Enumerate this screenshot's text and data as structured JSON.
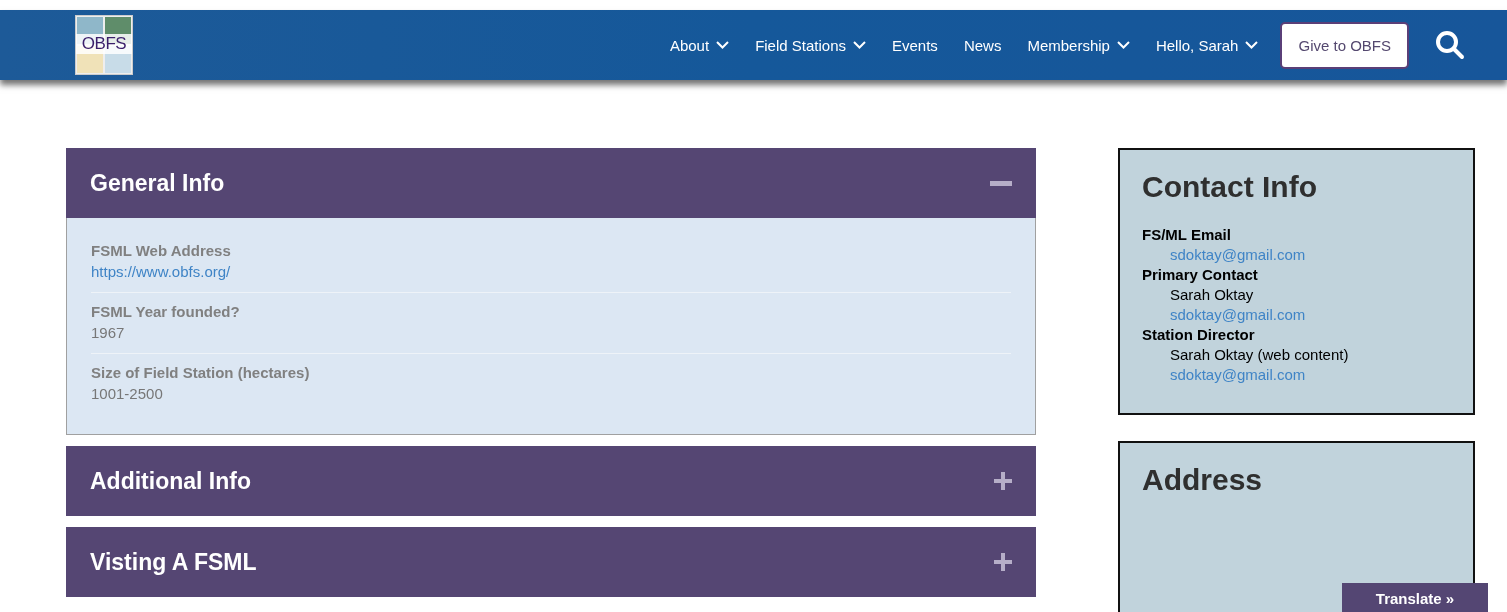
{
  "header": {
    "logo_text": "OBFS",
    "nav": [
      {
        "label": "About",
        "dropdown": true
      },
      {
        "label": "Field Stations",
        "dropdown": true
      },
      {
        "label": "Events",
        "dropdown": false
      },
      {
        "label": "News",
        "dropdown": false
      },
      {
        "label": "Membership",
        "dropdown": true
      },
      {
        "label": "Hello, Sarah",
        "dropdown": true
      }
    ],
    "give_button": "Give to OBFS"
  },
  "accordions": [
    {
      "title": "General Info",
      "expanded": true,
      "fields": [
        {
          "label": "FSML Web Address",
          "value": "https://www.obfs.org/",
          "kind": "link"
        },
        {
          "label": "FSML Year founded?",
          "value": "1967",
          "kind": "text"
        },
        {
          "label": "Size of Field Station (hectares)",
          "value": "1001-2500",
          "kind": "text"
        }
      ]
    },
    {
      "title": "Additional Info",
      "expanded": false
    },
    {
      "title": "Visting A FSML",
      "expanded": false
    }
  ],
  "contact_info": {
    "title": "Contact Info",
    "entries": [
      {
        "label": "FS/ML Email",
        "values": [
          {
            "text": "sdoktay@gmail.com",
            "kind": "link"
          }
        ]
      },
      {
        "label": "Primary Contact",
        "values": [
          {
            "text": "Sarah Oktay",
            "kind": "text"
          },
          {
            "text": "sdoktay@gmail.com",
            "kind": "link"
          }
        ]
      },
      {
        "label": "Station Director",
        "values": [
          {
            "text": "Sarah Oktay (web content)",
            "kind": "text"
          },
          {
            "text": "sdoktay@gmail.com",
            "kind": "link"
          }
        ]
      }
    ]
  },
  "address": {
    "title": "Address"
  },
  "translate_button": "Translate »"
}
